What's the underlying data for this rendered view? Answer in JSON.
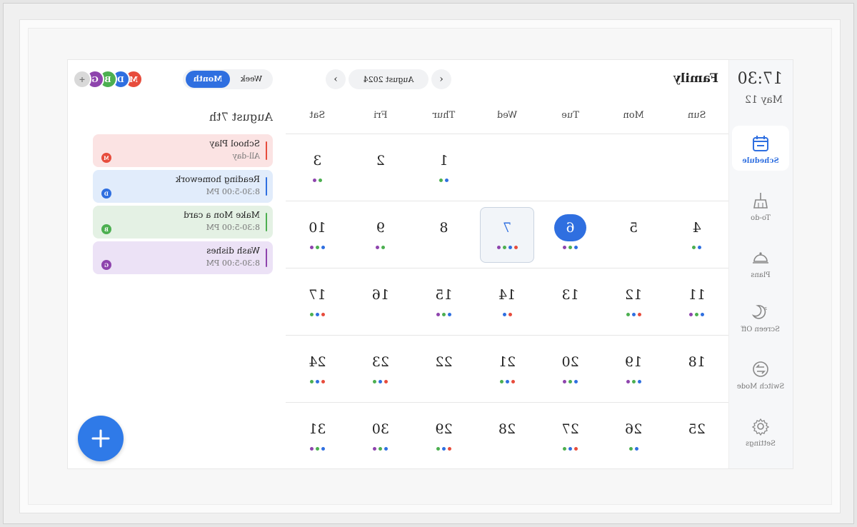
{
  "sidebar": {
    "time": "17:30",
    "date": "May 12",
    "items": [
      {
        "label": "Schedule",
        "icon": "calendar-icon"
      },
      {
        "label": "To-do",
        "icon": "broom-icon"
      },
      {
        "label": "Plans",
        "icon": "cloche-icon"
      },
      {
        "label": "Screen Off",
        "icon": "moon-icon"
      },
      {
        "label": "Switch Mode",
        "icon": "swap-icon"
      },
      {
        "label": "Settings",
        "icon": "gear-icon"
      }
    ]
  },
  "calendar": {
    "title": "Family",
    "month_label": "August 2024",
    "weekdays": [
      "Sun",
      "Mon",
      "Tue",
      "Wed",
      "Thur",
      "Fri",
      "Sat"
    ],
    "today": 6,
    "selected": 7,
    "weeks": [
      [
        null,
        null,
        null,
        null,
        1,
        2,
        3
      ],
      [
        4,
        5,
        6,
        7,
        8,
        9,
        10
      ],
      [
        11,
        12,
        13,
        14,
        15,
        16,
        17
      ],
      [
        18,
        19,
        20,
        21,
        22,
        23,
        24
      ],
      [
        25,
        26,
        27,
        28,
        29,
        30,
        31
      ]
    ],
    "dots": {
      "1": [
        "#2f6fe0",
        "#4caf50"
      ],
      "3": [
        "#4caf50",
        "#8e44ad"
      ],
      "4": [
        "#2f6fe0",
        "#4caf50"
      ],
      "6": [
        "#2f6fe0",
        "#4caf50",
        "#8e44ad"
      ],
      "7": [
        "#e74c3c",
        "#2f6fe0",
        "#4caf50",
        "#8e44ad"
      ],
      "9": [
        "#4caf50",
        "#8e44ad"
      ],
      "10": [
        "#2f6fe0",
        "#4caf50",
        "#8e44ad"
      ],
      "11": [
        "#2f6fe0",
        "#4caf50",
        "#8e44ad"
      ],
      "12": [
        "#e74c3c",
        "#2f6fe0",
        "#4caf50"
      ],
      "14": [
        "#e74c3c",
        "#2f6fe0"
      ],
      "15": [
        "#2f6fe0",
        "#4caf50",
        "#8e44ad"
      ],
      "17": [
        "#e74c3c",
        "#2f6fe0",
        "#4caf50"
      ],
      "19": [
        "#2f6fe0",
        "#4caf50",
        "#8e44ad"
      ],
      "20": [
        "#2f6fe0",
        "#4caf50",
        "#8e44ad"
      ],
      "21": [
        "#e74c3c",
        "#2f6fe0",
        "#4caf50"
      ],
      "23": [
        "#e74c3c",
        "#2f6fe0",
        "#4caf50"
      ],
      "24": [
        "#e74c3c",
        "#2f6fe0",
        "#4caf50"
      ],
      "26": [
        "#2f6fe0",
        "#4caf50"
      ],
      "27": [
        "#e74c3c",
        "#2f6fe0",
        "#4caf50"
      ],
      "29": [
        "#e74c3c",
        "#2f6fe0",
        "#4caf50"
      ],
      "30": [
        "#2f6fe0",
        "#4caf50",
        "#8e44ad"
      ],
      "31": [
        "#2f6fe0",
        "#4caf50",
        "#8e44ad"
      ]
    }
  },
  "agenda": {
    "view_week": "Week",
    "view_month": "Month",
    "avatars": [
      {
        "letter": "M",
        "color": "#e74c3c"
      },
      {
        "letter": "D",
        "color": "#2f6fe0"
      },
      {
        "letter": "B",
        "color": "#4caf50"
      },
      {
        "letter": "G",
        "color": "#8e44ad"
      },
      {
        "letter": "+",
        "color": "#bdbdbd"
      }
    ],
    "date_heading": "August 7th",
    "events": [
      {
        "title": "School Play",
        "time": "All-day",
        "badge": "M",
        "bg": "#fbe3e3",
        "accent": "#e74c3c"
      },
      {
        "title": "Reading homework",
        "time": "8:30-5:00 PM",
        "badge": "D",
        "bg": "#e1ecfb",
        "accent": "#2f6fe0"
      },
      {
        "title": "Make Mon a card",
        "time": "8:30-5:00 PM",
        "badge": "B",
        "bg": "#e4f1e4",
        "accent": "#4caf50"
      },
      {
        "title": "Wash dishes",
        "time": "8:30-5:00 PM",
        "badge": "G",
        "bg": "#ece2f6",
        "accent": "#8e44ad"
      }
    ],
    "add_label": "+"
  }
}
